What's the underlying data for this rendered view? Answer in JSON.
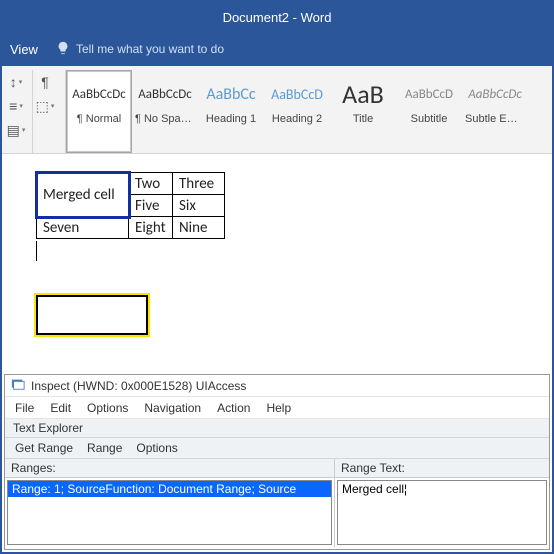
{
  "titlebar": {
    "title": "Document2  -  Word"
  },
  "tabs": {
    "view": "View"
  },
  "tellme": {
    "placeholder": "Tell me what you want to do"
  },
  "ribbon": {
    "styles": [
      {
        "preview": "AaBbCcDc",
        "label": "¶ Normal",
        "size": "13px",
        "color": "#333",
        "italic": false
      },
      {
        "preview": "AaBbCcDc",
        "label": "¶ No Spac…",
        "size": "13px",
        "color": "#333",
        "italic": false
      },
      {
        "preview": "AaBbCc",
        "label": "Heading 1",
        "size": "16px",
        "color": "#5b9bd5",
        "italic": false
      },
      {
        "preview": "AaBbCcD",
        "label": "Heading 2",
        "size": "14px",
        "color": "#5b9bd5",
        "italic": false
      },
      {
        "preview": "AaB",
        "label": "Title",
        "size": "26px",
        "color": "#333",
        "italic": false
      },
      {
        "preview": "AaBbCcD",
        "label": "Subtitle",
        "size": "13px",
        "color": "#888",
        "italic": false
      },
      {
        "preview": "AaBbCcDc",
        "label": "Subtle Em…",
        "size": "13px",
        "color": "#888",
        "italic": true
      }
    ]
  },
  "table": {
    "r1c1": "Merged cell",
    "r1c2": "Two",
    "r1c3": "Three",
    "r2c2": "Five",
    "r2c3": "Six",
    "r3c1": "Seven",
    "r3c2": "Eight",
    "r3c3": "Nine"
  },
  "inspect": {
    "title": "Inspect  (HWND: 0x000E1528)  UIAccess",
    "menu": {
      "file": "File",
      "edit": "Edit",
      "options": "Options",
      "navigation": "Navigation",
      "action": "Action",
      "help": "Help"
    },
    "subtool": "Text Explorer",
    "tools": {
      "getrange": "Get Range",
      "range": "Range",
      "options": "Options"
    },
    "ranges_header": "Ranges:",
    "rangetext_header": "Range Text:",
    "range_item": "Range: 1; SourceFunction: Document Range; Source",
    "range_text": "Merged cell¦"
  }
}
